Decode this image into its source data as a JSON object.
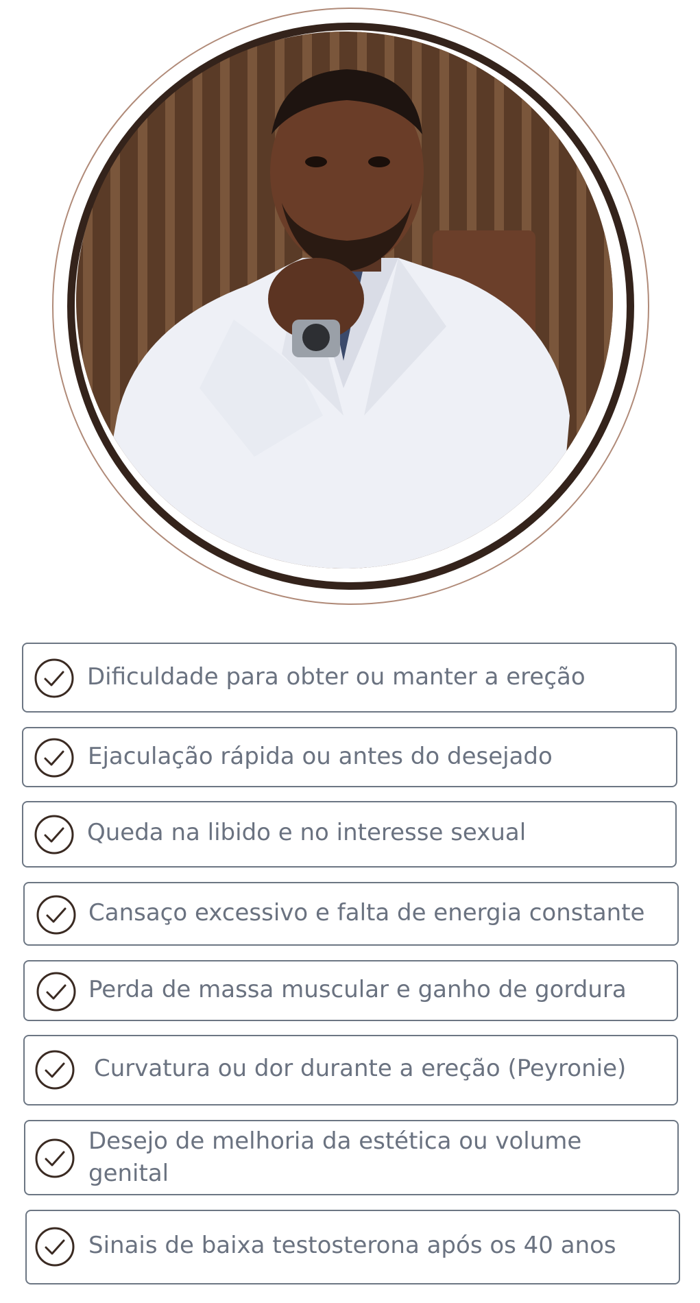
{
  "portrait": {
    "icon": "doctor-portrait",
    "colors": {
      "outer_ring": "#b08a78",
      "inner_ring": "#34231b",
      "background_panels": "#5a3b27",
      "coat": "#f2f3f8"
    }
  },
  "symptoms": [
    {
      "label": "Dificuldade para obter ou manter a ereção",
      "icon": "check-circle-icon"
    },
    {
      "label": "Ejaculação rápida ou antes do desejado",
      "icon": "check-circle-icon"
    },
    {
      "label": "Queda na libido e no interesse sexual",
      "icon": "check-circle-icon"
    },
    {
      "label": "Cansaço excessivo e falta de energia constante",
      "icon": "check-circle-icon"
    },
    {
      "label": "Perda de massa muscular e ganho de gordura",
      "icon": "check-circle-icon"
    },
    {
      "label": "Curvatura ou dor durante a ereção (Peyronie)",
      "icon": "check-circle-icon"
    },
    {
      "label": "Desejo de melhoria da estética ou volume genital",
      "icon": "check-circle-icon"
    },
    {
      "label": "Sinais de baixa testosterona após os 40 anos",
      "icon": "check-circle-icon"
    }
  ],
  "colors": {
    "text": "#6a7280",
    "border": "#6c7683",
    "check": "#3a2a22"
  }
}
